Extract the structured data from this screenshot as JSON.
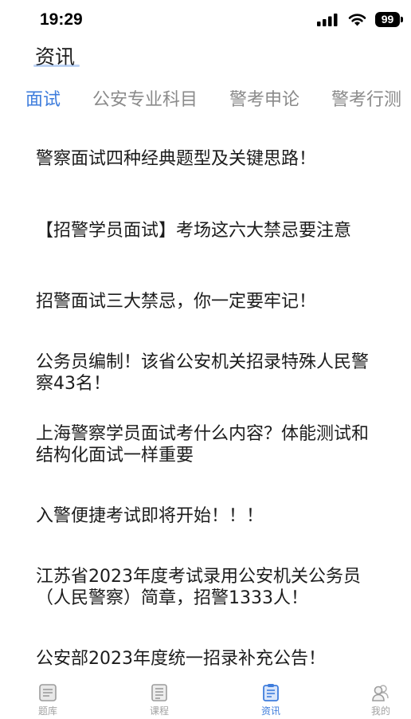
{
  "status_bar": {
    "time": "19:29",
    "battery": "99",
    "icons": [
      "cellular-signal-icon",
      "wifi-icon",
      "battery-icon"
    ]
  },
  "header": {
    "title": "资讯"
  },
  "tabs": [
    {
      "label": "面试",
      "active": true
    },
    {
      "label": "公安专业科目",
      "active": false
    },
    {
      "label": "警考申论",
      "active": false
    },
    {
      "label": "警考行测",
      "active": false
    }
  ],
  "articles": [
    {
      "title": "警察面试四种经典题型及关键思路！"
    },
    {
      "title": "【招警学员面试】考场这六大禁忌要注意"
    },
    {
      "title": "招警面试三大禁忌，你一定要牢记！"
    },
    {
      "title": "公务员编制！该省公安机关招录特殊人民警察43名！"
    },
    {
      "title": "上海警察学员面试考什么内容？体能测试和结构化面试一样重要"
    },
    {
      "title": "入警便捷考试即将开始！！！"
    },
    {
      "title": "江苏省2023年度考试录用公安机关公务员（人民警察）简章，招警1333人！"
    },
    {
      "title": "公安部2023年度统一招录补充公告！"
    }
  ],
  "bottom_nav": [
    {
      "label": "题库",
      "icon": "question-bank-icon",
      "active": false
    },
    {
      "label": "课程",
      "icon": "course-icon",
      "active": false
    },
    {
      "label": "资讯",
      "icon": "news-icon",
      "active": true
    },
    {
      "label": "我的",
      "icon": "profile-icon",
      "active": false
    }
  ],
  "colors": {
    "accent": "#3f7ddc",
    "text": "#1c1c1c",
    "muted": "#8a8a8a",
    "nav_muted": "#a3a3a3"
  }
}
